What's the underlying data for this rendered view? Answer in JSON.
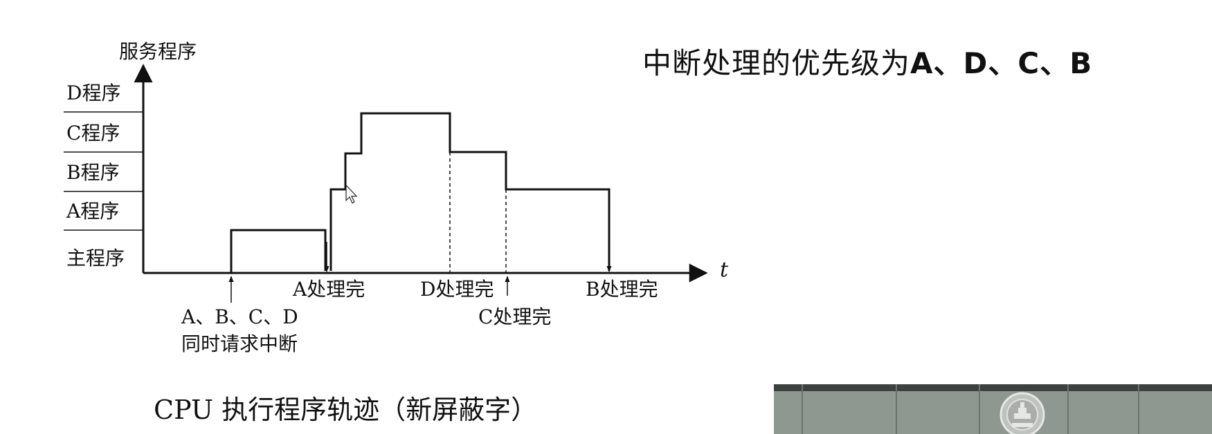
{
  "diagram": {
    "y_axis_title": "服务程序",
    "x_axis_symbol": "t",
    "levels": [
      "D程序",
      "C程序",
      "B程序",
      "A程序",
      "主程序"
    ],
    "events": {
      "request_line1": "A、B、C、D",
      "request_line2": "同时请求中断",
      "a_done": "A处理完",
      "d_done": "D处理完",
      "c_done": "C处理完",
      "b_done": "B处理完"
    }
  },
  "priority": {
    "prefix": "中断处理的优先级为",
    "order": "A、D、C、B"
  },
  "caption": "CPU 执行程序轨迹（新屏蔽字）",
  "colors": {
    "line": "#111111",
    "video_bg": "#8f9791"
  },
  "icons": [
    "cursor-arrow-icon",
    "university-logo-icon"
  ]
}
